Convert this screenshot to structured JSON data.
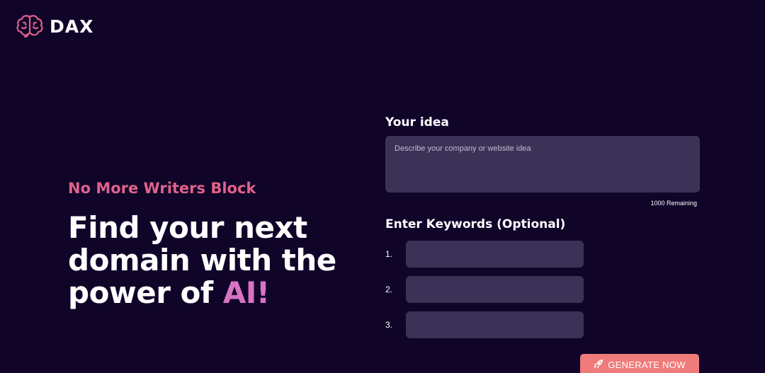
{
  "brand": {
    "name": "DAX",
    "icon": "brain-icon",
    "icon_color": "#e0628a"
  },
  "hero": {
    "tagline": "No More Writers Block",
    "headline_line1": "Find your next",
    "headline_line2": "domain with the",
    "headline_line3_prefix": "power of ",
    "headline_accent": "AI!",
    "tagline_color": "#e0628a",
    "accent_color": "#d873c4"
  },
  "form": {
    "idea_label": "Your idea",
    "idea_placeholder": "Describe your company or website idea",
    "idea_value": "",
    "remaining_text": "1000 Remaining",
    "keywords_label": "Enter Keywords (Optional)",
    "keywords": [
      {
        "number": "1.",
        "value": ""
      },
      {
        "number": "2.",
        "value": ""
      },
      {
        "number": "3.",
        "value": ""
      }
    ]
  },
  "generate_button": {
    "label": "GENERATE NOW",
    "icon": "rocket-icon",
    "color": "#ef7b7b"
  },
  "colors": {
    "background": "#100429",
    "field": "#3c3257"
  }
}
